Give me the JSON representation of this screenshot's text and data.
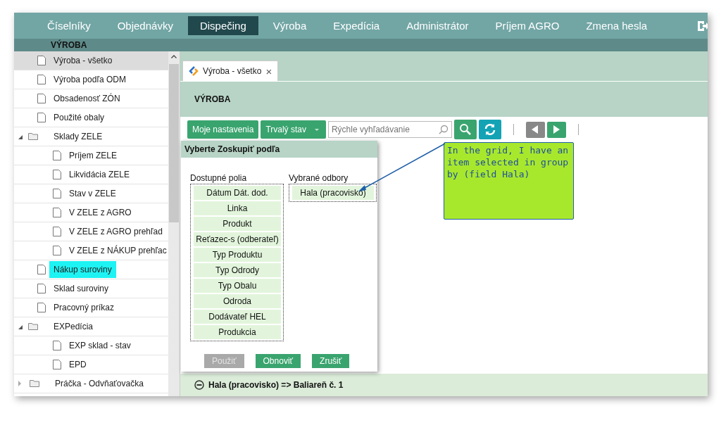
{
  "nav": [
    {
      "label": "Číselníky",
      "selected": false
    },
    {
      "label": "Objednávky",
      "selected": false
    },
    {
      "label": "Dispečing",
      "selected": true
    },
    {
      "label": "Výroba",
      "selected": false
    },
    {
      "label": "Expedícia",
      "selected": false
    },
    {
      "label": "Administrátor",
      "selected": false
    },
    {
      "label": "Príjem AGRO",
      "selected": false
    },
    {
      "label": "Zmena hesla",
      "selected": false
    }
  ],
  "sidebar": {
    "title": "VÝROBA",
    "items": [
      {
        "label": "Výroba - všetko",
        "selected": true,
        "highlighted": false
      },
      {
        "label": "Výroba podľa ODM",
        "selected": false,
        "highlighted": false
      },
      {
        "label": "Obsadenosť ZÓN",
        "selected": false,
        "highlighted": false
      },
      {
        "label": "Použité obaly",
        "selected": false,
        "highlighted": false
      },
      {
        "label": "Sklady ZELE",
        "kind": "folder",
        "selected": false,
        "highlighted": false,
        "expanded": true,
        "children": [
          {
            "label": "Príjem ZELE",
            "selected": false,
            "highlighted": false
          },
          {
            "label": "Likvidácia ZELE",
            "selected": false,
            "highlighted": false
          },
          {
            "label": "Stav v ZELE",
            "selected": false,
            "highlighted": false
          },
          {
            "label": "V ZELE z AGRO",
            "selected": false,
            "highlighted": false
          },
          {
            "label": "V ZELE z AGRO prehľad",
            "selected": false,
            "highlighted": false
          },
          {
            "label": "V ZELE z NÁKUP prehľac",
            "selected": false,
            "highlighted": false
          }
        ]
      },
      {
        "label": "Nákup suroviny",
        "selected": false,
        "highlighted": true
      },
      {
        "label": "Sklad suroviny",
        "selected": false,
        "highlighted": false
      },
      {
        "label": "Pracovný príkaz",
        "selected": false,
        "highlighted": false
      },
      {
        "label": "EXPedícia",
        "kind": "folder",
        "selected": false,
        "highlighted": false,
        "expanded": true,
        "children": [
          {
            "label": "EXP sklad - stav",
            "selected": false,
            "highlighted": false
          },
          {
            "label": "EPD",
            "selected": false,
            "highlighted": false
          }
        ]
      },
      {
        "label": "Práčka - Odvňaťovačka",
        "kind": "folder",
        "selected": false,
        "highlighted": false,
        "expanded": false
      }
    ]
  },
  "tab": {
    "label": "Výroba - všetko",
    "close": "×"
  },
  "page_title": "VÝROBA",
  "toolbar": {
    "settings": "Moje nastavenia",
    "state": "Trvalý stav",
    "search": {
      "placeholder": "Rýchle vyhľadávanie"
    }
  },
  "dialog": {
    "title": "Vyberte Zoskupiť podľa",
    "available_label": "Dostupné polia",
    "selected_label": "Vybrané odbory",
    "available": [
      "Dátum Dát. dod.",
      "Linka",
      "Produkt",
      "Reťazec-s (odberateľ)",
      "Typ Produktu",
      "Typ Odrody",
      "Typ Obalu",
      "Odroda",
      "Dodávateľ HEL",
      "Produkcia"
    ],
    "chosen": [
      "Hala (pracovisko)"
    ],
    "buttons": [
      {
        "label": "Použiť",
        "disabled": true
      },
      {
        "label": "Obnoviť",
        "disabled": false
      },
      {
        "label": "Zrušiť",
        "disabled": false
      }
    ]
  },
  "callout": "In the grid, I have an item selected in group by (field Hala)",
  "group_row": "Hala (pracovisko) => Baliareň č. 1"
}
